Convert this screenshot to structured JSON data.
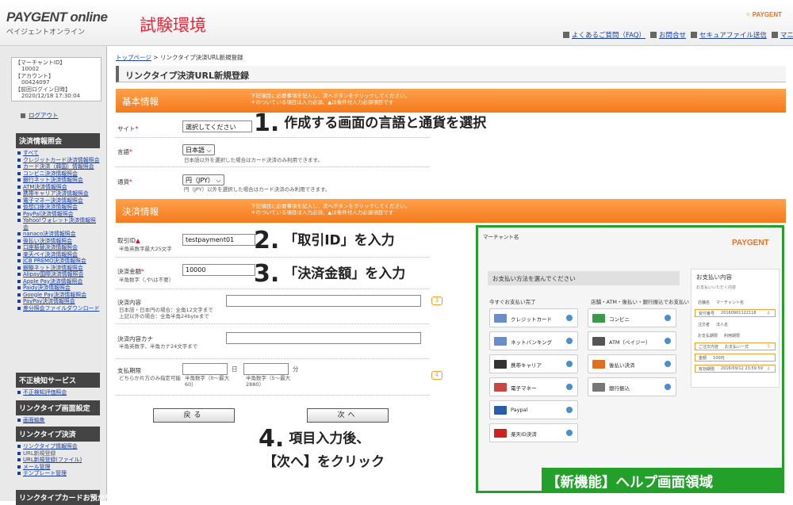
{
  "header": {
    "logo_main": "PAYGENT online",
    "logo_sub": "ペイジェントオンライン",
    "env_title": "試験環境",
    "brand": "PAYGENT",
    "nav": [
      "よくあるご質問（FAQ）",
      "お問合せ",
      "セキュアファイル送信",
      "マニュアル"
    ]
  },
  "account": {
    "lines": [
      "【マーチャントID】",
      "10002",
      "【アカウント】",
      "00424097",
      "【前回ログイン日時】",
      "2020/12/18 17:30:04"
    ],
    "logout": "ログアウト"
  },
  "sidebar": {
    "sections": [
      {
        "title": "決済情報照会",
        "items": [
          "すべて",
          "クレジットカード決済情報照会",
          "カード決済（韓国）情報照会",
          "コンビニ決済情報照会",
          "銀行ネット決済情報照会",
          "ATM決済情報照会",
          "携帯キャリア決済情報照会",
          "電子マネー決済情報照会",
          "仮想口座決済情報照会",
          "PayPal決済情報照会",
          "Yahoo!ウォレット決済情報照会",
          "nanaco決済情報照会",
          "後払い決済情報照会",
          "口座振替決済情報照会",
          "楽天ペイ決済情報照会",
          "JCB PREMO決済情報照会",
          "銀聯ネット決済情報照会",
          "Alipay国際決済情報照会",
          "Apple Pay決済情報照会",
          "Paidy決済情報照会",
          "Google Pay決済情報照会",
          "PayPay決済情報照会",
          "差分照会ファイルダウンロード"
        ]
      },
      {
        "title": "不正検知サービス",
        "items": [
          "不正検知評価照会"
        ]
      },
      {
        "title": "リンクタイプ画面設定",
        "items": [
          "画面編集"
        ]
      },
      {
        "title": "リンクタイプ決済",
        "items": [
          "リンクタイプ情報照会",
          "URL新規登録",
          "URL新規登録(ファイル)",
          "メール管理",
          "テンプレート管理"
        ]
      },
      {
        "title": "リンクタイプカードお預かり",
        "items": []
      }
    ]
  },
  "breadcrumb": {
    "home": "トップページ",
    "sep": " > ",
    "current": "リンクタイプ決済URL新規登録"
  },
  "page_title": "リンクタイプ決済URL新規登録",
  "bands": {
    "basic": "基本情報",
    "payment": "決済情報",
    "note1": "下記項目に必要事項を記入し、次へボタンをクリックしてください。",
    "note2": "＊のついている項目は入力必須、▲は条件付入力必須項目です"
  },
  "form": {
    "site_label": "サイト",
    "site_value": "選択してください",
    "lang_label": "言語",
    "lang_value": "日本語",
    "lang_note": "日本語以外を選択した場合はカード決済のみ利用できます。",
    "cur_label": "通貨",
    "cur_value": "円（JPY）",
    "cur_note": "円（JPY）以外を選択した場合はカード決済のみ利用できます。",
    "trade_label": "取引ID",
    "trade_mark": "▲",
    "trade_note": "半角英数字最大25文字",
    "trade_value": "testpayment01",
    "amount_label": "決済金額",
    "amount_note": "半角数字（,や\\は不要）",
    "amount_value": "10000",
    "content_label": "決済内容",
    "content_note1": "日本語・日本円の場合：全角12文字まで",
    "content_note2": "上記以外の場合：全角半角24byteまで",
    "kana_label": "決済内容カナ",
    "kana_note": "半角英数字、半角カナ24文字まで",
    "limit_label": "支払期限",
    "limit_note": "どちらか片方のみ指定可能",
    "day_unit": "日",
    "min_unit": "分",
    "day_note1": "半角数字（0～最大",
    "day_note2": "60）",
    "min_note1": "半角数字（5～最大",
    "min_note2": "2880）",
    "back_btn": "戻る",
    "next_btn": "次へ"
  },
  "annotations": [
    {
      "num": "1.",
      "text": "作成する画面の言語と通貨を選択"
    },
    {
      "num": "2.",
      "text": "「取引ID」を入力"
    },
    {
      "num": "3.",
      "text": "「決済金額」を入力"
    },
    {
      "num": "4.",
      "text": "項目入力後、",
      "text2": "【次へ】をクリック"
    }
  ],
  "tips": [
    "3",
    "4"
  ],
  "help": {
    "label": "【新機能】ヘルプ画面領域",
    "merchant": "マーチャント名",
    "logo": "PAYGENT",
    "choose": "お支払い方法を選んでください",
    "q1": "今すぐお支払い完了",
    "q2": "店舗・ATM・後払い・銀行振込でお支払い",
    "methods_left": [
      "クレジットカード",
      "ネットバンキング",
      "携帯キャリア",
      "電子マネー",
      "Paypal",
      "楽天ID決済"
    ],
    "methods_right": [
      "コンビニ",
      "ATM（ペイジー）",
      "後払い決済",
      "銀行振込"
    ],
    "detail_title": "お支払い内容",
    "detail_sub": "お支払いいただく内容",
    "rows": [
      [
        "店舗名",
        "マーチャント名"
      ],
      [
        "受付番号",
        "20160901122118"
      ],
      [
        "注文者",
        "法人名"
      ],
      [
        "お支払期限",
        "利用期限"
      ],
      [
        "ご注文内容",
        "お支払いー式"
      ],
      [
        "金額",
        "100円"
      ],
      [
        "有効期限",
        "2016/09/12 23:59:59"
      ]
    ]
  },
  "colors": {
    "orange": "#f47a1e",
    "green": "#22a02a",
    "red": "#e22233",
    "link": "#1a3fa0"
  }
}
